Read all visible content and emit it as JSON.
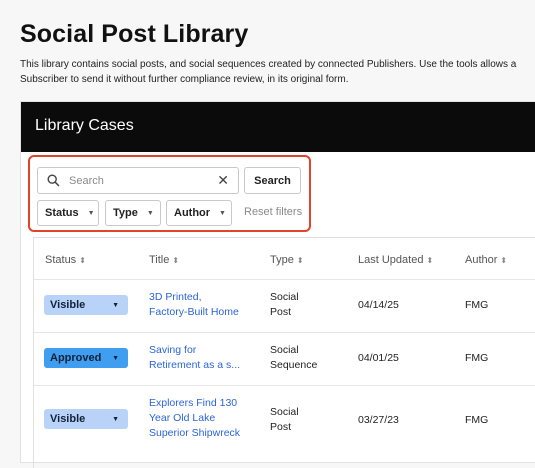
{
  "page": {
    "title": "Social Post Library",
    "description": "This library contains social posts, and social sequences created by connected Publishers. Use the tools allows a Subscriber to send it without further compliance review, in its original form."
  },
  "panel": {
    "title": "Library Cases"
  },
  "filters": {
    "search_placeholder": "Search",
    "clear_glyph": "✕",
    "search_button": "Search",
    "status_label": "Status",
    "type_label": "Type",
    "author_label": "Author",
    "reset_label": "Reset filters"
  },
  "table": {
    "headers": [
      "Status",
      "Title",
      "Type",
      "Last Updated",
      "Author"
    ],
    "rows": [
      {
        "status": "Visible",
        "status_color": "#b9d3f8",
        "title_line1": "3D Printed,",
        "title_line2": "Factory-Built Home",
        "title_line3": "",
        "type_line1": "Social",
        "type_line2": "Post",
        "date": "04/14/25",
        "author": "FMG"
      },
      {
        "status": "Approved",
        "status_color": "#3f9ef0",
        "title_line1": "Saving for",
        "title_line2": "Retirement as a s...",
        "title_line3": "",
        "type_line1": "Social",
        "type_line2": "Sequence",
        "date": "04/01/25",
        "author": "FMG"
      },
      {
        "status": "Visible",
        "status_color": "#b9d3f8",
        "title_line1": "Explorers Find 130",
        "title_line2": "Year Old Lake",
        "title_line3": "Superior Shipwreck",
        "type_line1": "Social",
        "type_line2": "Post",
        "date": "03/27/23",
        "author": "FMG"
      }
    ]
  },
  "icons": {
    "search": "search-icon",
    "sort": "sort-icon",
    "caret": "caret-down-icon"
  },
  "colors": {
    "header_bg": "#0b0b0b",
    "highlight_border": "#e2432b",
    "link": "#2c64d6"
  }
}
